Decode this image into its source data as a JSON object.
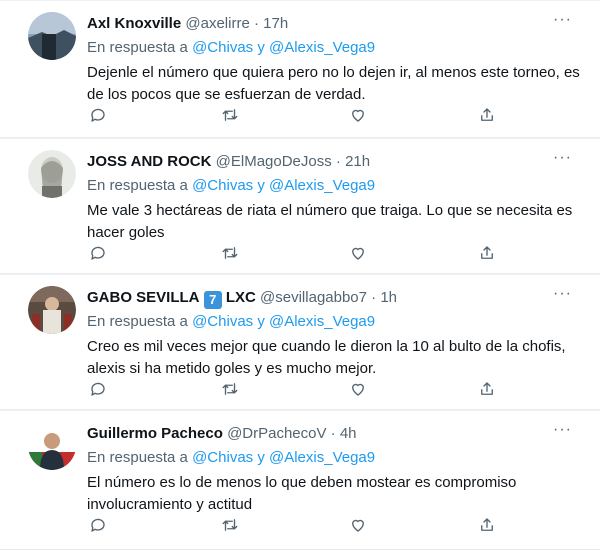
{
  "tweets": [
    {
      "name": "Axl Knoxville",
      "handle": "@axelirre",
      "time": "17h",
      "reply_prefix": "En respuesta a",
      "reply_users": "@Chivas y @Alexis_Vega9",
      "text": "Dejenle el número que quiera pero no lo dejen ir, al menos este torneo, es de los pocos que se esfuerzan de verdad."
    },
    {
      "name": "JOSS AND ROCK",
      "handle": "@ElMagoDeJoss",
      "time": "21h",
      "reply_prefix": "En respuesta a",
      "reply_users": "@Chivas y @Alexis_Vega9",
      "text": "Me vale 3 hectáreas de riata el número que traiga. Lo que se necesita es hacer goles"
    },
    {
      "name": "GABO SEVILLA",
      "badge": "7",
      "name_suffix": "LXC",
      "handle": "@sevillagabbo7",
      "time": "1h",
      "reply_prefix": "En respuesta a",
      "reply_users": "@Chivas y @Alexis_Vega9",
      "text": "Creo es mil veces mejor que cuando le dieron la 10 al bulto de la chofis, alexis si ha metido goles y es mucho mejor."
    },
    {
      "name": "Guillermo Pacheco",
      "handle": "@DrPachecoV",
      "time": "4h",
      "reply_prefix": "En respuesta a",
      "reply_users": "@Chivas y @Alexis_Vega9",
      "text": "El número es lo de menos lo que deben mostear es compromiso involucramiento y actitud"
    }
  ],
  "separator": "·",
  "more_glyph": "···",
  "icons": [
    "reply-icon",
    "retweet-icon",
    "like-icon",
    "share-icon",
    "more-icon"
  ],
  "colors": {
    "link": "#1d9bf0",
    "muted": "#536471",
    "text": "#0f1419",
    "badge": "#3b94d9"
  }
}
